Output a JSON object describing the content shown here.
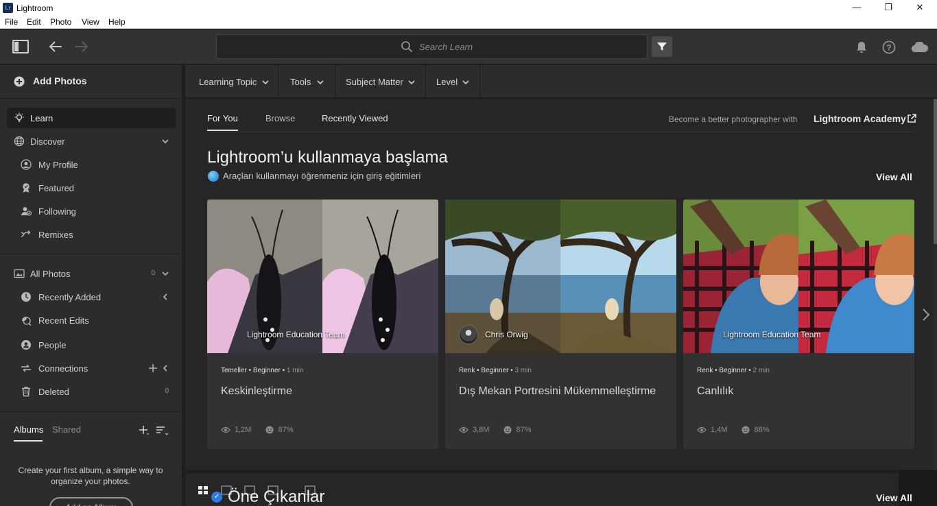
{
  "window": {
    "logo_text": "Lr",
    "title": "Lightroom",
    "controls": {
      "minimize": "—",
      "maximize": "❐",
      "close": "✕"
    }
  },
  "menu": [
    "File",
    "Edit",
    "Photo",
    "View",
    "Help"
  ],
  "search": {
    "placeholder": "Search Learn"
  },
  "sidebar": {
    "add_photos": "Add Photos",
    "nav": [
      {
        "label": "Learn",
        "icon": "lightbulb-icon"
      },
      {
        "label": "Discover",
        "icon": "globe-icon"
      },
      {
        "label": "My Profile",
        "icon": "profile-icon"
      },
      {
        "label": "Featured",
        "icon": "award-icon"
      },
      {
        "label": "Following",
        "icon": "following-icon"
      },
      {
        "label": "Remixes",
        "icon": "remix-icon"
      }
    ],
    "library": [
      {
        "label": "All Photos",
        "icon": "photos-icon",
        "count": "0"
      },
      {
        "label": "Recently Added",
        "icon": "clock-icon"
      },
      {
        "label": "Recent Edits",
        "icon": "edit-icon"
      },
      {
        "label": "People",
        "icon": "person-icon"
      },
      {
        "label": "Connections",
        "icon": "connections-icon"
      },
      {
        "label": "Deleted",
        "icon": "trash-icon",
        "count": "0"
      }
    ],
    "albums_tabs": [
      "Albums",
      "Shared"
    ],
    "empty_albums_text": "Create your first album, a simple way to organize your photos.",
    "add_album_label": "Add an Album"
  },
  "filters": [
    "Learning Topic",
    "Tools",
    "Subject Matter",
    "Level"
  ],
  "tabs": [
    "For You",
    "Browse",
    "Recently Viewed"
  ],
  "academy": {
    "text": "Become a better photographer with",
    "link": "Lightroom Academy"
  },
  "section": {
    "title": "Lightroom’u kullanmaya başlama",
    "subtitle": "Araçları kullanmayı öğrenmeniz için giriş eğitimleri",
    "view_all": "View All"
  },
  "cards": [
    {
      "author": "Lightroom Education Team",
      "topic": "Temeller",
      "level": "Beginner",
      "duration": "1 min",
      "title": "Keskinleştirme",
      "views": "1,2M",
      "rating": "87%"
    },
    {
      "author": "Chris Orwig",
      "topic": "Renk",
      "level": "Beginner",
      "duration": "3 min",
      "title": "Dış Mekan Portresini Mükemmelleştirme",
      "views": "3,8M",
      "rating": "87%"
    },
    {
      "author": "Lightroom Education Team",
      "topic": "Renk",
      "level": "Beginner",
      "duration": "2 min",
      "title": "Canlılık",
      "views": "1,4M",
      "rating": "88%"
    }
  ],
  "highlights": {
    "title": "Öne Çıkanlar",
    "view_all": "View All"
  },
  "colors": {
    "background": "#1e1e1e",
    "panel": "#2c2c2c",
    "card": "#323232",
    "accent": "#2d7be0"
  }
}
